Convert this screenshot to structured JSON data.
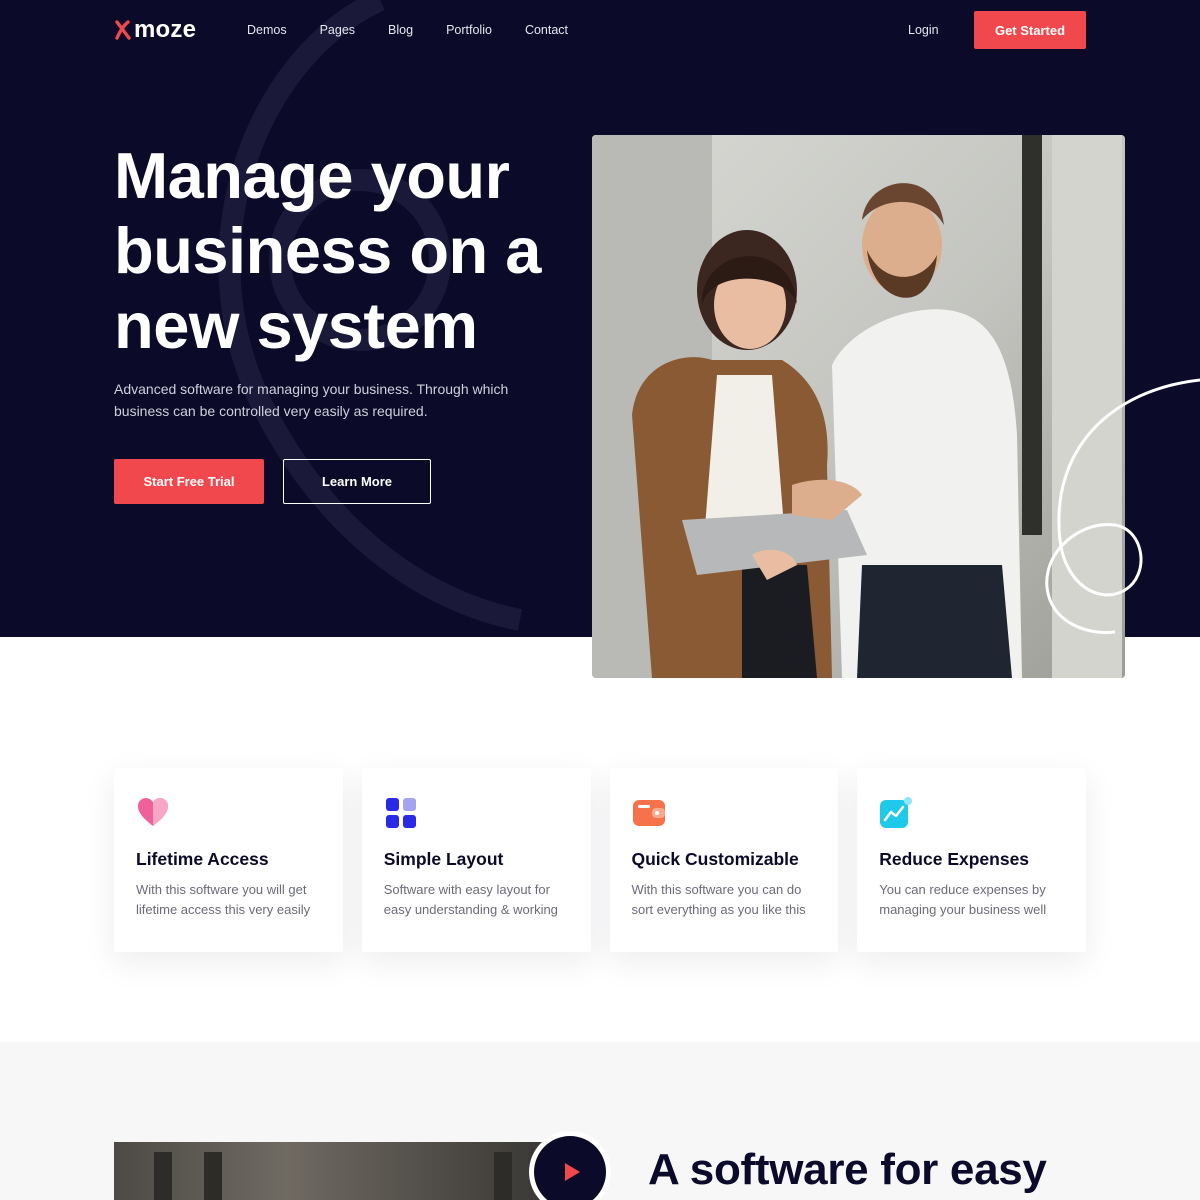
{
  "brand": {
    "name": "moze",
    "accent": "#f0484c",
    "dark": "#0b0a28"
  },
  "nav": {
    "links": [
      "Demos",
      "Pages",
      "Blog",
      "Portfolio",
      "Contact"
    ],
    "login": "Login",
    "cta": "Get Started"
  },
  "hero": {
    "title": "Manage your business on a new system",
    "subtitle": "Advanced software for managing your business. Through which business can be controlled very easily as required.",
    "primary_button": "Start Free Trial",
    "secondary_button": "Learn More",
    "image_alt": "two colleagues looking at a tablet"
  },
  "features": [
    {
      "icon": "heart-icon",
      "icon_color": "#f0609a",
      "title": "Lifetime Access",
      "text": "With this software you will get lifetime access this very easily"
    },
    {
      "icon": "grid-icon",
      "icon_color": "#2a2ae6",
      "title": "Simple Layout",
      "text": "Software with easy layout for easy understanding & working"
    },
    {
      "icon": "wallet-icon",
      "icon_color": "#f5724a",
      "title": "Quick Customizable",
      "text": "With this software you can do sort everything as you like this"
    },
    {
      "icon": "chart-icon",
      "icon_color": "#1ec9ea",
      "title": "Reduce Expenses",
      "text": "You can reduce expenses by managing your business well"
    }
  ],
  "section2": {
    "title": "A software for easy"
  }
}
